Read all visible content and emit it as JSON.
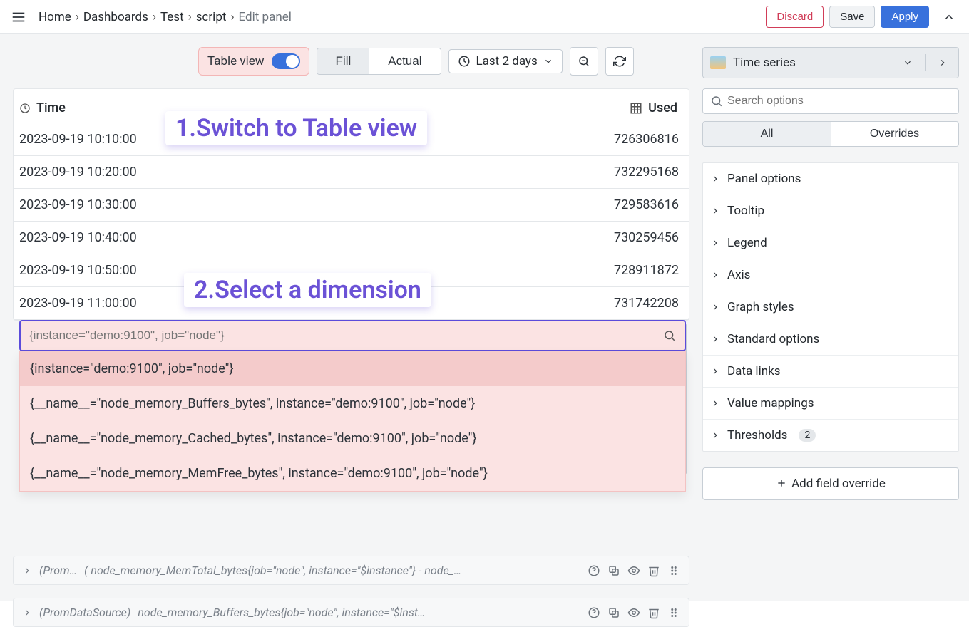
{
  "breadcrumb": [
    "Home",
    "Dashboards",
    "Test",
    "script",
    "Edit panel"
  ],
  "topbar": {
    "discard": "Discard",
    "save": "Save",
    "apply": "Apply"
  },
  "viewToolbar": {
    "tableView": "Table view",
    "fill": "Fill",
    "actual": "Actual",
    "timeRange": "Last 2 days"
  },
  "table": {
    "headers": {
      "time": "Time",
      "used": "Used"
    },
    "rows": [
      {
        "ts": "2023-09-19 10:10:00",
        "val": "726306816"
      },
      {
        "ts": "2023-09-19 10:20:00",
        "val": "732295168"
      },
      {
        "ts": "2023-09-19 10:30:00",
        "val": "729583616"
      },
      {
        "ts": "2023-09-19 10:40:00",
        "val": "730259456"
      },
      {
        "ts": "2023-09-19 10:50:00",
        "val": "728911872"
      },
      {
        "ts": "2023-09-19 11:00:00",
        "val": "731742208"
      }
    ]
  },
  "combo": {
    "placeholder": "{instance=\"demo:9100\", job=\"node\"}",
    "options": [
      "{instance=\"demo:9100\", job=\"node\"}",
      "{__name__=\"node_memory_Buffers_bytes\", instance=\"demo:9100\", job=\"node\"}",
      "{__name__=\"node_memory_Cached_bytes\", instance=\"demo:9100\", job=\"node\"}",
      "{__name__=\"node_memory_MemFree_bytes\", instance=\"demo:9100\", job=\"node\"}"
    ]
  },
  "annotations": {
    "a1": "1.Switch to Table view",
    "a2": "2.Select a dimension"
  },
  "queries": [
    {
      "ds": "(Prom…",
      "expr": "( node_memory_MemTotal_bytes{job=\"node\", instance=\"$instance\"} - node_…"
    },
    {
      "ds": "(PromDataSource)",
      "expr": "node_memory_Buffers_bytes{job=\"node\", instance=\"$inst…"
    }
  ],
  "right": {
    "visualization": "Time series",
    "searchPlaceholder": "Search options",
    "tabs": {
      "all": "All",
      "overrides": "Overrides"
    },
    "options": [
      {
        "label": "Panel options"
      },
      {
        "label": "Tooltip"
      },
      {
        "label": "Legend"
      },
      {
        "label": "Axis"
      },
      {
        "label": "Graph styles"
      },
      {
        "label": "Standard options"
      },
      {
        "label": "Data links"
      },
      {
        "label": "Value mappings"
      },
      {
        "label": "Thresholds",
        "badge": "2"
      }
    ],
    "addOverride": "Add field override"
  }
}
